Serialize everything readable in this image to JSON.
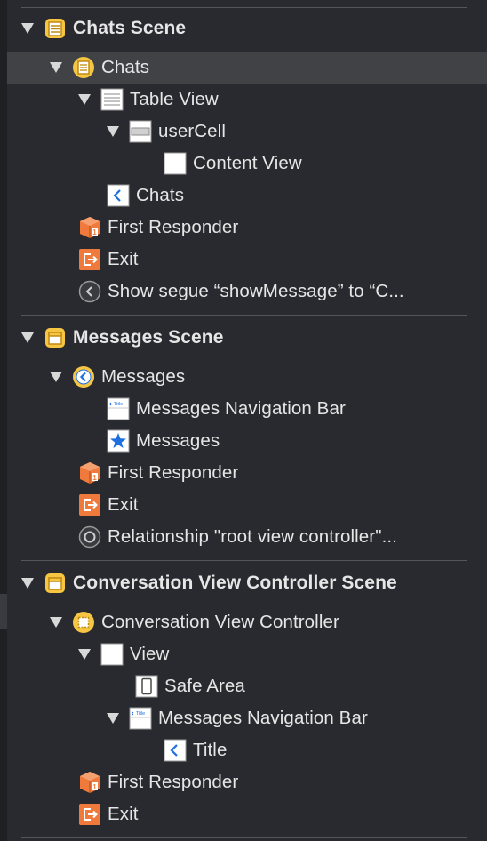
{
  "outline": {
    "chats_scene": {
      "title": "Chats Scene",
      "controller": "Chats",
      "table_view": "Table View",
      "user_cell": "userCell",
      "content_view": "Content View",
      "nav_item": "Chats",
      "first_responder": "First Responder",
      "exit": "Exit",
      "segue": "Show segue “showMessage” to “C..."
    },
    "messages_scene": {
      "title": "Messages Scene",
      "controller": "Messages",
      "nav_bar": "Messages Navigation Bar",
      "tab_bar_item": "Messages",
      "first_responder": "First Responder",
      "exit": "Exit",
      "relationship": "Relationship \"root view controller\"..."
    },
    "conversation_scene": {
      "title": "Conversation View Controller Scene",
      "controller": "Conversation View Controller",
      "view": "View",
      "safe_area": "Safe Area",
      "nav_bar": "Messages Navigation Bar",
      "nav_title": "Title",
      "first_responder": "First Responder",
      "exit": "Exit"
    }
  },
  "icons": {
    "nav_bar_icon_text": "Title"
  },
  "colors": {
    "background": "#292a2f",
    "selected_row": "#414246",
    "scene_yellow": "#f6c643",
    "exit_orange": "#ef7a3b",
    "link_blue": "#1f6fe0"
  }
}
